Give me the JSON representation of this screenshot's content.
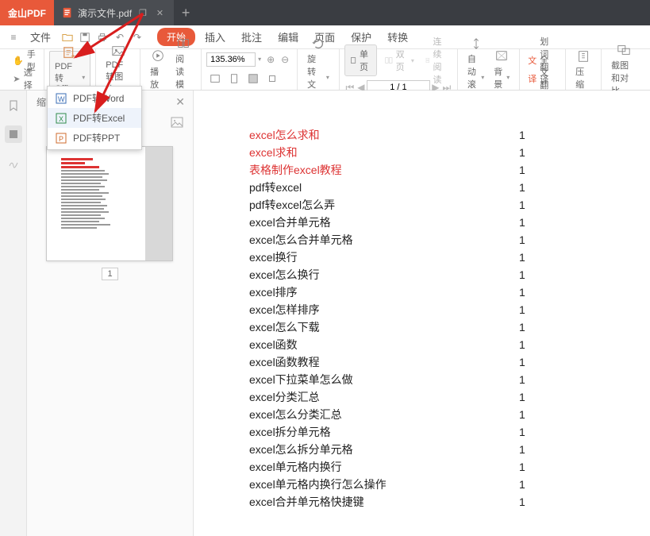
{
  "titlebar": {
    "brand": "金山PDF",
    "tabs": [
      {
        "label": "演示文件.pdf"
      }
    ],
    "newtab": "+"
  },
  "menubar": {
    "file": "文件",
    "items": [
      "开始",
      "插入",
      "批注",
      "编辑",
      "页面",
      "保护",
      "转换"
    ]
  },
  "toolbar": {
    "hand": "手型",
    "select": "选择",
    "pdf2office": "PDF转Office",
    "pdf2img": "PDF转图片",
    "play": "播放",
    "readmode": "阅读模式",
    "zoom_value": "135.36%",
    "rotate": "旋转文档",
    "singlepage": "单页",
    "doublepage": "双页",
    "contread": "连续阅读",
    "autoscroll": "自动滚动",
    "background": "背景",
    "wordtrans": "划词翻译",
    "fulltrans": "全文翻译",
    "compress": "压缩",
    "screenshot": "截图和对比",
    "page_field": "1 / 1"
  },
  "dropdown": {
    "items": [
      "PDF转Word",
      "PDF转Excel",
      "PDF转PPT"
    ]
  },
  "thumbpanel": {
    "title": "缩略图",
    "page_number": "1"
  },
  "document": {
    "rows": [
      {
        "text": "excel怎么求和",
        "v": "1",
        "red": true
      },
      {
        "text": "excel求和",
        "v": "1",
        "red": true
      },
      {
        "text": "表格制作excel教程",
        "v": "1",
        "red": true
      },
      {
        "text": "pdf转excel",
        "v": "1"
      },
      {
        "text": "pdf转excel怎么弄",
        "v": "1"
      },
      {
        "text": "excel合并单元格",
        "v": "1"
      },
      {
        "text": "excel怎么合并单元格",
        "v": "1"
      },
      {
        "text": "excel换行",
        "v": "1"
      },
      {
        "text": "excel怎么换行",
        "v": "1"
      },
      {
        "text": "excel排序",
        "v": "1"
      },
      {
        "text": "excel怎样排序",
        "v": "1"
      },
      {
        "text": "excel怎么下载",
        "v": "1"
      },
      {
        "text": "excel函数",
        "v": "1"
      },
      {
        "text": "excel函数教程",
        "v": "1"
      },
      {
        "text": "excel下拉菜单怎么做",
        "v": "1"
      },
      {
        "text": "excel分类汇总",
        "v": "1"
      },
      {
        "text": "excel怎么分类汇总",
        "v": "1"
      },
      {
        "text": "excel拆分单元格",
        "v": "1"
      },
      {
        "text": "excel怎么拆分单元格",
        "v": "1"
      },
      {
        "text": "excel单元格内换行",
        "v": "1"
      },
      {
        "text": "excel单元格内换行怎么操作",
        "v": "1"
      },
      {
        "text": "excel合并单元格快捷键",
        "v": "1"
      }
    ]
  }
}
